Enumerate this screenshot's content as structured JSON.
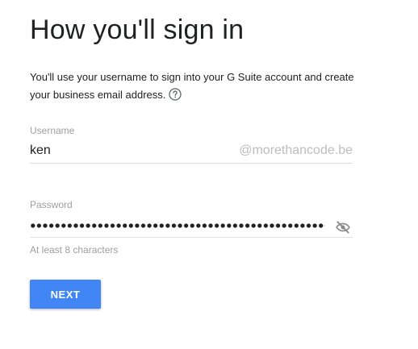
{
  "title": "How you'll sign in",
  "description": "You'll use your username to sign into your G Suite account and create your business email address.",
  "username": {
    "label": "Username",
    "value": "ken",
    "domain_suffix": "@morethancode.be"
  },
  "password": {
    "label": "Password",
    "visibility_icon": "eye-off-icon",
    "hint": "At least 8 characters"
  },
  "help_icon": "question-circle-icon",
  "next_button": {
    "label": "NEXT",
    "color": "#4285f4"
  }
}
